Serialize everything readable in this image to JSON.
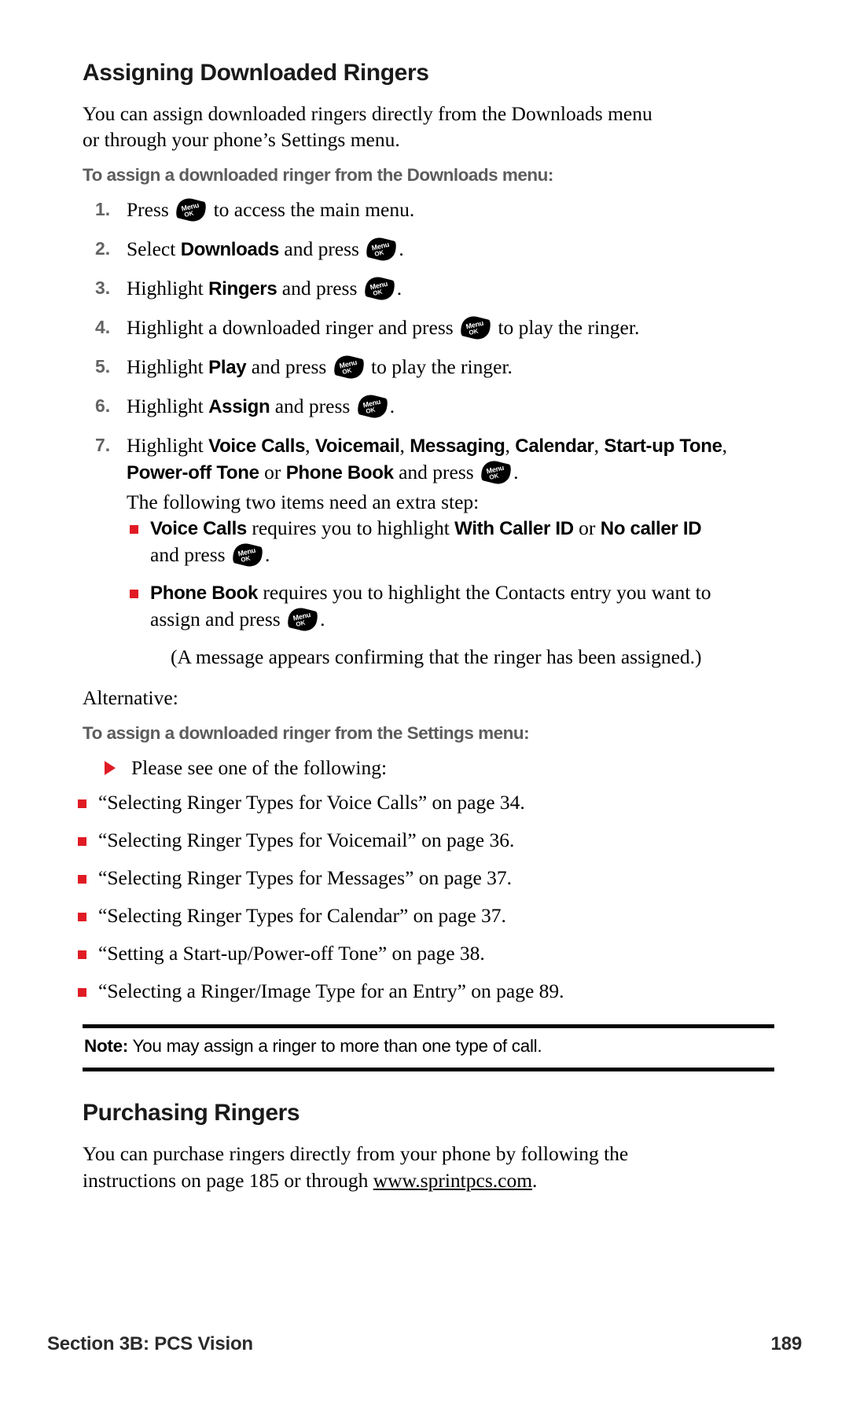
{
  "page": {
    "heading": "Assigning Downloaded Ringers",
    "intro": "You can assign downloaded ringers directly from the Downloads menu or through your phone’s Settings menu.",
    "subhead_downloads": "To assign a downloaded ringer from the Downloads menu:",
    "steps": [
      {
        "num": "1.",
        "pre": "Press ",
        "key": "menu-ok-key",
        "post": " to access the main menu."
      },
      {
        "num": "2.",
        "pre": "Select ",
        "bold1": "Downloads",
        "mid": " and press ",
        "key": "menu-ok-key",
        "post": "."
      },
      {
        "num": "3.",
        "pre": "Highlight ",
        "bold1": "Ringers",
        "mid": " and press ",
        "key": "menu-ok-key",
        "post": "."
      },
      {
        "num": "4.",
        "pre": "Highlight a downloaded ringer and press ",
        "key": "menu-ok-key",
        "post": " to play the ringer."
      },
      {
        "num": "5.",
        "pre": "Highlight ",
        "bold1": "Play",
        "mid": " and press ",
        "key": "menu-ok-key",
        "post": " to play the ringer."
      },
      {
        "num": "6.",
        "pre": "Highlight ",
        "bold1": "Assign",
        "mid": " and press ",
        "key": "menu-ok-key",
        "post": "."
      }
    ],
    "step7": {
      "num": "7.",
      "pre": "Highlight ",
      "options": [
        "Voice Calls",
        "Voicemail",
        "Messaging",
        "Calendar",
        "Start-up Tone",
        "Power-off Tone"
      ],
      "or_word": " or ",
      "last_option": "Phone Book",
      "mid": " and press ",
      "key": "menu-ok-key",
      "post": ".",
      "extra_line": "The following two items need an extra step:",
      "sub_bullets": [
        {
          "bold1": "Voice Calls",
          "text1": " requires you to highlight ",
          "bold2": "With Caller ID",
          "text2": " or ",
          "bold3": "No caller ID",
          "text3": " and press ",
          "key": "menu-ok-key",
          "text4": "."
        },
        {
          "bold1": "Phone Book",
          "text1": " requires you to highlight the Contacts entry you want to assign and press ",
          "key": "menu-ok-key",
          "text4": "."
        }
      ],
      "confirm_note": "(A message appears confirming that the ringer has been assigned.)"
    },
    "alternative_label": "Alternative:",
    "subhead_settings": "To assign a downloaded ringer from the Settings menu:",
    "arrow_item": "Please see one of the following:",
    "references": [
      "“Selecting Ringer Types for Voice Calls” on page 34.",
      "“Selecting Ringer Types for Voicemail” on page 36.",
      "“Selecting Ringer Types for Messages” on page 37.",
      "“Selecting Ringer Types for Calendar” on page 37.",
      "“Setting a Start-up/Power-off Tone” on page 38.",
      "“Selecting a Ringer/Image Type for an Entry” on page 89."
    ],
    "note": {
      "label": "Note:",
      "text": " You may assign a ringer to more than one type of call."
    },
    "purchasing": {
      "heading": "Purchasing Ringers",
      "text_before": "You can purchase ringers directly from your phone by following the instructions on page 185 or through ",
      "link": "www.sprintpcs.com",
      "text_after": "."
    },
    "footer": {
      "section": "Section 3B: PCS Vision",
      "page_number": "189"
    },
    "icons": {
      "menu_ok_menu": "Menu",
      "menu_ok_ok": "OK"
    },
    "colors": {
      "bullet_red": "#e01b24",
      "subhead_gray": "#5c5c5c",
      "rule_black": "#000000"
    }
  }
}
